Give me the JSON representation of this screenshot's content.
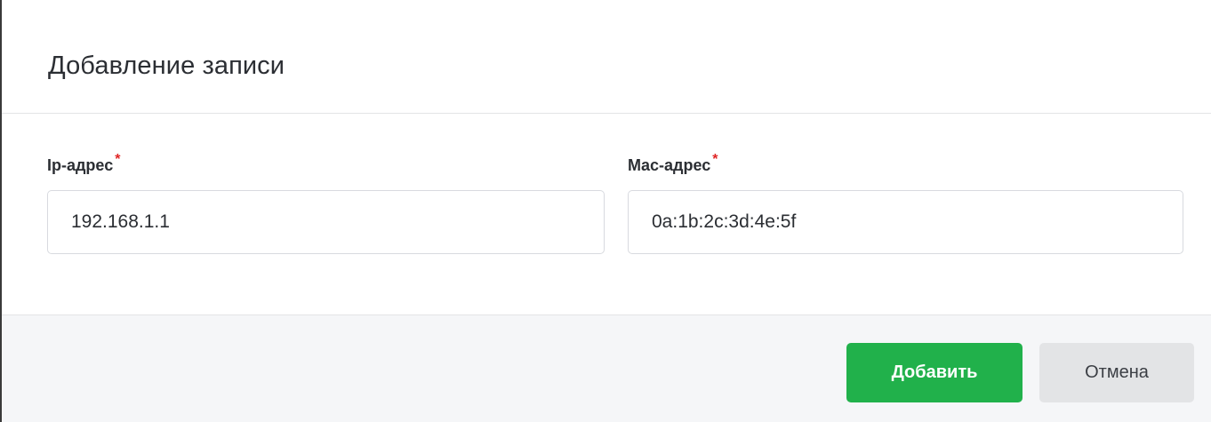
{
  "dialog": {
    "title": "Добавление записи"
  },
  "fields": {
    "ip": {
      "label": "Ip-адрес",
      "required_mark": "*",
      "value": "192.168.1.1"
    },
    "mac": {
      "label": "Mac-адрес",
      "required_mark": "*",
      "value": "0a:1b:2c:3d:4e:5f"
    }
  },
  "footer": {
    "add_label": "Добавить",
    "cancel_label": "Отмена"
  },
  "colors": {
    "primary": "#21b14b",
    "required": "#e02424",
    "secondary_bg": "#e3e4e6",
    "footer_bg": "#f5f6f8"
  }
}
